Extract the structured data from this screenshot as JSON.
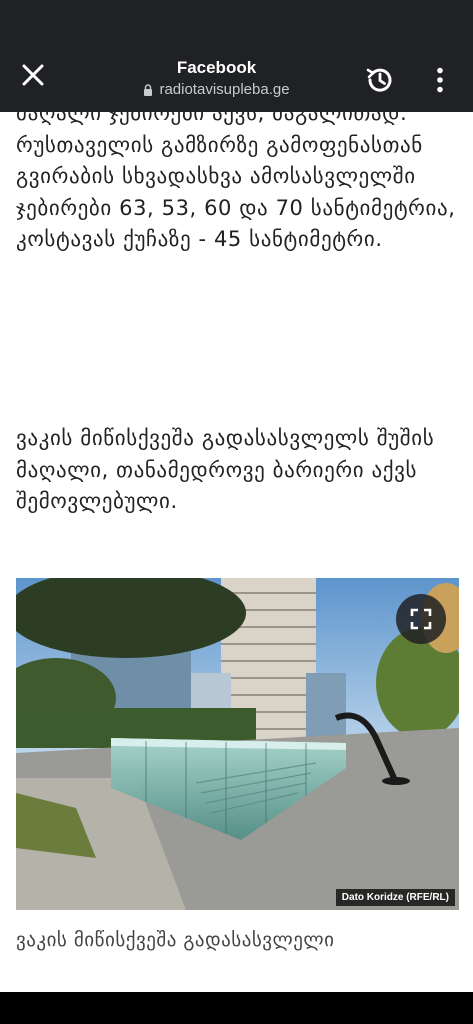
{
  "app_bar": {
    "title": "Facebook",
    "url": "radiotavisupleba.ge",
    "close_icon": "close-icon",
    "history_icon": "history-icon",
    "more_icon": "more-vert-icon",
    "lock_icon": "lock-icon"
  },
  "article": {
    "paragraph_1": "მაღალი ჯებირები აქვს, მაგალითად: რუსთაველის გამზირზე გამოფენასთან გვირაბის სხვადასხვა ამოსასვლელში ჯებირები 63, 53, 60 და 70 სანტიმეტრია, კოსტავას ქუჩაზე - 45 სანტიმეტრი.",
    "paragraph_2": "ვაკის მიწისქვეშა გადასასვლელს შუშის მაღალი, თანამედროვე ბარიერი აქვს შემოვლებული.",
    "figure": {
      "credit": "Dato Koridze (RFE/RL)",
      "caption": "ვაკის მიწისქვეშა გადასასვლელი",
      "expand_icon": "fullscreen-icon"
    }
  },
  "colors": {
    "app_bar_bg": "#202124",
    "text": "#222222",
    "caption_text": "#444444"
  }
}
